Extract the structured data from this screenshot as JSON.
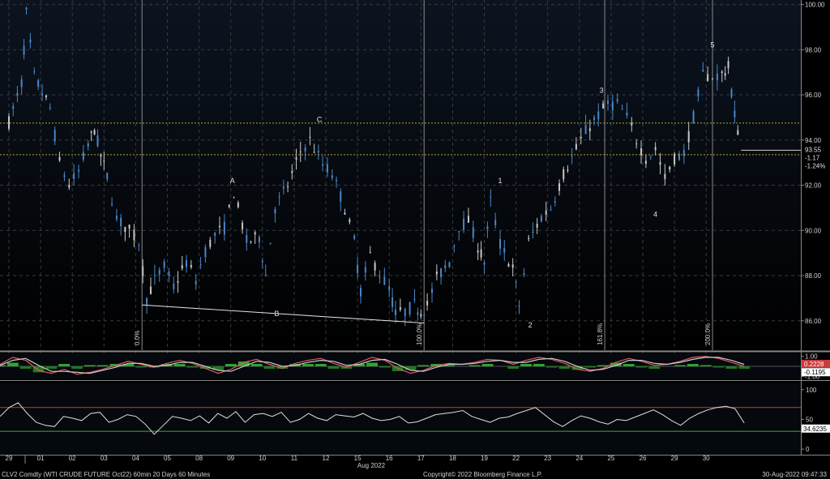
{
  "chart_data": [
    {
      "type": "candlestick",
      "panel": "price",
      "x_tick_labels": [
        "29",
        "01",
        "02",
        "03",
        "04",
        "05",
        "08",
        "09",
        "10",
        "11",
        "12",
        "15",
        "16",
        "17",
        "18",
        "19",
        "22",
        "23",
        "24",
        "25",
        "26",
        "29",
        "30"
      ],
      "month_label": "Aug 2022",
      "y_ticks": [
        "100.00",
        "98.00",
        "96.00",
        "94.00",
        "92.00",
        "90.00",
        "88.00",
        "86.00"
      ],
      "ylim": [
        84.7,
        100.2
      ],
      "grid": true,
      "ohlc_path": [
        [
          0,
          94.8
        ],
        [
          0.4,
          96.5
        ],
        [
          0.55,
          99.6
        ],
        [
          0.8,
          96.8
        ],
        [
          1.3,
          95.4
        ],
        [
          1.6,
          93.0
        ],
        [
          1.9,
          92.0
        ],
        [
          2.2,
          92.6
        ],
        [
          2.5,
          93.8
        ],
        [
          2.7,
          94.5
        ],
        [
          2.9,
          93.3
        ],
        [
          3.1,
          92.4
        ],
        [
          3.4,
          90.5
        ],
        [
          3.8,
          90.0
        ],
        [
          4.1,
          89.5
        ],
        [
          4.35,
          87.0
        ],
        [
          4.6,
          87.8
        ],
        [
          4.9,
          88.4
        ],
        [
          5.2,
          87.5
        ],
        [
          5.6,
          88.6
        ],
        [
          5.9,
          87.8
        ],
        [
          6.2,
          89.1
        ],
        [
          6.5,
          89.8
        ],
        [
          6.8,
          90.1
        ],
        [
          7.1,
          91.7
        ],
        [
          7.5,
          89.5
        ],
        [
          7.9,
          89.7
        ],
        [
          8.1,
          88.0
        ],
        [
          8.4,
          91.0
        ],
        [
          8.8,
          92.0
        ],
        [
          9.2,
          93.5
        ],
        [
          9.5,
          94.0
        ],
        [
          9.9,
          92.9
        ],
        [
          10.2,
          92.5
        ],
        [
          10.6,
          91.0
        ],
        [
          10.9,
          89.5
        ],
        [
          11.1,
          87.3
        ],
        [
          11.4,
          88.9
        ],
        [
          11.7,
          88.1
        ],
        [
          12.0,
          87.4
        ],
        [
          12.2,
          86.3
        ],
        [
          12.5,
          86.4
        ],
        [
          12.8,
          86.7
        ],
        [
          13.0,
          86.4
        ],
        [
          13.2,
          86.7
        ],
        [
          13.5,
          87.9
        ],
        [
          13.9,
          88.6
        ],
        [
          14.2,
          90.2
        ],
        [
          14.5,
          90.4
        ],
        [
          14.8,
          89.3
        ],
        [
          15.0,
          88.6
        ],
        [
          15.2,
          91.3
        ],
        [
          15.5,
          89.4
        ],
        [
          15.9,
          88.3
        ],
        [
          16.1,
          86.7
        ],
        [
          16.4,
          89.5
        ],
        [
          16.8,
          90.6
        ],
        [
          17.1,
          91.0
        ],
        [
          17.5,
          92.5
        ],
        [
          17.9,
          93.6
        ],
        [
          18.2,
          94.4
        ],
        [
          18.6,
          95.1
        ],
        [
          18.9,
          95.6
        ],
        [
          19.2,
          95.6
        ],
        [
          19.5,
          95.0
        ],
        [
          19.8,
          94.0
        ],
        [
          20.1,
          93.2
        ],
        [
          20.4,
          93.6
        ],
        [
          20.7,
          92.3
        ],
        [
          21.0,
          93.2
        ],
        [
          21.3,
          93.4
        ],
        [
          21.6,
          95.0
        ],
        [
          21.9,
          96.9
        ],
        [
          22.2,
          96.8
        ],
        [
          22.5,
          96.9
        ],
        [
          22.7,
          97.2
        ],
        [
          22.9,
          95.1
        ],
        [
          23.1,
          93.8
        ]
      ],
      "current_price": "93.55",
      "change": "-1.17",
      "change_pct": "-1.24%",
      "hlines": [
        94.75,
        93.35
      ],
      "fib_levels": [
        {
          "label": "0.0%",
          "x": 4.2
        },
        {
          "label": "100.0%",
          "x": 13.1
        },
        {
          "label": "161.8%",
          "x": 18.8
        },
        {
          "label": "200.0%",
          "x": 22.2
        }
      ],
      "wave_labels": [
        {
          "text": "A",
          "x": 7.05,
          "y": 92.1
        },
        {
          "text": "B",
          "x": 8.45,
          "y": 86.2
        },
        {
          "text": "C",
          "x": 9.8,
          "y": 94.8
        },
        {
          "text": "1",
          "x": 15.5,
          "y": 92.1
        },
        {
          "text": "2",
          "x": 16.45,
          "y": 85.7
        },
        {
          "text": "3",
          "x": 18.7,
          "y": 96.1
        },
        {
          "text": "4",
          "x": 20.4,
          "y": 90.6
        },
        {
          "text": "5",
          "x": 22.2,
          "y": 98.1
        }
      ],
      "trendline": [
        [
          4.2,
          86.7
        ],
        [
          13.1,
          85.9
        ]
      ]
    },
    {
      "type": "line",
      "panel": "macd",
      "y_ticks": [
        "1.00",
        "-1.00"
      ],
      "ylim": [
        -1.3,
        1.3
      ],
      "series": [
        {
          "color": "#e05a6a",
          "values": [
            0.2,
            0.9,
            0.6,
            -0.4,
            -0.7,
            -0.3,
            -0.8,
            -0.6,
            -0.3,
            0.1,
            0.5,
            0.2,
            -0.1,
            0.3,
            0.6,
            0.3,
            -0.2,
            -0.7,
            -0.3,
            0.4,
            0.7,
            0.2,
            -0.2,
            0.3,
            0.6,
            0.8,
            0.3,
            -0.1,
            0.4,
            0.9,
            0.6,
            -0.2,
            -0.7,
            -0.4,
            0.1,
            0.3,
            0.2,
            0.4,
            0.7,
            0.6,
            0.2,
            0.6,
            0.9,
            0.7,
            0.3,
            -0.3,
            -0.5,
            -0.2,
            0.4,
            0.8,
            0.5,
            0.1,
            0.2,
            0.5,
            0.9,
            1.0,
            0.8,
            0.4,
            0.0
          ]
        },
        {
          "color": "#cccccc",
          "values": [
            0.1,
            0.6,
            0.8,
            0.1,
            -0.5,
            -0.5,
            -0.6,
            -0.7,
            -0.4,
            -0.1,
            0.3,
            0.3,
            0.0,
            0.1,
            0.4,
            0.4,
            0.0,
            -0.4,
            -0.5,
            0.0,
            0.5,
            0.4,
            0.0,
            0.1,
            0.4,
            0.6,
            0.5,
            0.1,
            0.2,
            0.6,
            0.7,
            0.2,
            -0.4,
            -0.5,
            -0.1,
            0.2,
            0.2,
            0.3,
            0.5,
            0.6,
            0.4,
            0.4,
            0.7,
            0.8,
            0.5,
            0.0,
            -0.4,
            -0.3,
            0.1,
            0.6,
            0.6,
            0.3,
            0.2,
            0.4,
            0.7,
            0.9,
            0.9,
            0.6,
            0.2
          ]
        }
      ],
      "value_labels": [
        "0.2228",
        "-0.1195"
      ]
    },
    {
      "type": "line",
      "panel": "rsi",
      "y_ticks": [
        "100",
        "50",
        "0"
      ],
      "ylim": [
        -8,
        112
      ],
      "hlines": [
        70,
        30
      ],
      "series": [
        {
          "color": "#e0e0e0",
          "values": [
            55,
            70,
            78,
            60,
            45,
            40,
            38,
            55,
            52,
            48,
            60,
            62,
            45,
            50,
            58,
            55,
            42,
            25,
            40,
            55,
            52,
            48,
            56,
            44,
            60,
            52,
            63,
            45,
            58,
            60,
            55,
            62,
            45,
            50,
            60,
            52,
            48,
            58,
            56,
            54,
            60,
            52,
            48,
            50,
            55,
            44,
            46,
            52,
            58,
            60,
            62,
            65,
            55,
            50,
            45,
            52,
            54,
            60,
            65,
            70,
            58,
            46,
            38,
            48,
            56,
            52,
            46,
            42,
            50,
            48,
            54,
            60,
            66,
            58,
            48,
            40,
            52,
            60,
            66,
            70,
            72,
            68,
            44
          ]
        }
      ],
      "value_label": "34.6235"
    }
  ],
  "footer": {
    "left": "CLV2 Comdty (WTI CRUDE FUTURE  Oct22) 60min 20 Days 60 Minutes",
    "center": "Copyright© 2022 Bloomberg Finance L.P.",
    "right": "30-Aug-2022 09:47:33"
  },
  "colors": {
    "background": "#000000",
    "candle": "#4a86c8",
    "candle_light": "#c8c8c8",
    "grid": "#3a3a3a",
    "fib_line": "#8a8a8a",
    "yellow_line": "#b8a23a",
    "rsi_high": "#c83c3c",
    "rsi_low": "#3caa3c",
    "macd_hist_pos": "#2ca82c",
    "macd_hist_neg": "#1e7a1e"
  }
}
